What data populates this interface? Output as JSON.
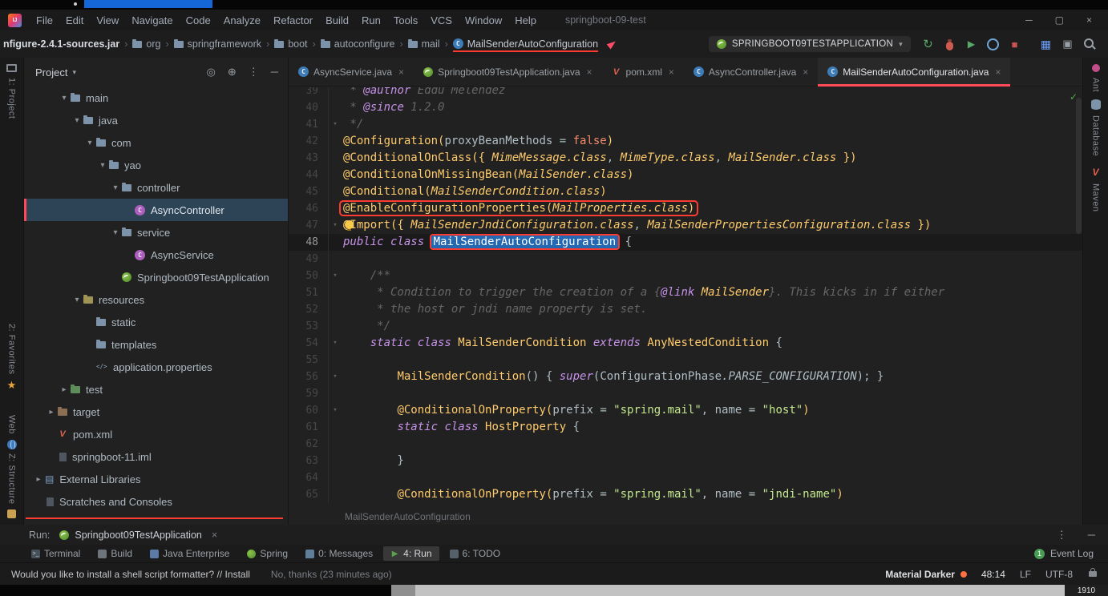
{
  "chrome": {
    "title": "springboot-09-test",
    "menus": [
      "File",
      "Edit",
      "View",
      "Navigate",
      "Code",
      "Analyze",
      "Refactor",
      "Build",
      "Run",
      "Tools",
      "VCS",
      "Window",
      "Help"
    ],
    "window_controls": {
      "minimize": "─",
      "maximize": "▢",
      "close": "×"
    }
  },
  "breadcrumb": {
    "segments": [
      {
        "label": "nfigure-2.4.1-sources.jar",
        "icon": "none",
        "bold": true
      },
      {
        "label": "org",
        "icon": "folder"
      },
      {
        "label": "springframework",
        "icon": "folder"
      },
      {
        "label": "boot",
        "icon": "folder"
      },
      {
        "label": "autoconfigure",
        "icon": "folder"
      },
      {
        "label": "mail",
        "icon": "folder"
      },
      {
        "label": "MailSenderAutoConfiguration",
        "icon": "class",
        "underline": true
      }
    ]
  },
  "run_config": {
    "name": "SPRINGBOOT09TESTAPPLICATION"
  },
  "toolbar_actions": [
    "rerun",
    "debug",
    "run-coverage",
    "profiler",
    "stop",
    "view-grid",
    "console",
    "search"
  ],
  "project_panel": {
    "header_label": "Project",
    "tree": [
      {
        "label": "main",
        "icon": "folder",
        "level": 2,
        "chevron": "down"
      },
      {
        "label": "java",
        "icon": "folder",
        "level": 3,
        "chevron": "down"
      },
      {
        "label": "com",
        "icon": "folder",
        "level": 4,
        "chevron": "down"
      },
      {
        "label": "yao",
        "icon": "folder",
        "level": 5,
        "chevron": "down"
      },
      {
        "label": "controller",
        "icon": "package",
        "level": 6,
        "chevron": "down"
      },
      {
        "label": "AsyncController",
        "icon": "class",
        "level": 7,
        "chevron": "none",
        "selected": true
      },
      {
        "label": "service",
        "icon": "package",
        "level": 6,
        "chevron": "down"
      },
      {
        "label": "AsyncService",
        "icon": "class",
        "level": 7,
        "chevron": "none"
      },
      {
        "label": "Springboot09TestApplication",
        "icon": "spring",
        "level": 6,
        "chevron": "none"
      },
      {
        "label": "resources",
        "icon": "folder-res",
        "level": 3,
        "chevron": "down"
      },
      {
        "label": "static",
        "icon": "folder",
        "level": 4,
        "chevron": "none"
      },
      {
        "label": "templates",
        "icon": "folder",
        "level": 4,
        "chevron": "none"
      },
      {
        "label": "application.properties",
        "icon": "props",
        "level": 4,
        "chevron": "none"
      },
      {
        "label": "test",
        "icon": "folder-test",
        "level": 2,
        "chevron": "right"
      },
      {
        "label": "target",
        "icon": "folder-target",
        "level": 1,
        "chevron": "right"
      },
      {
        "label": "pom.xml",
        "icon": "maven",
        "level": 1,
        "chevron": "none"
      },
      {
        "label": "springboot-11.iml",
        "icon": "file",
        "level": 1,
        "chevron": "none"
      },
      {
        "label": "External Libraries",
        "icon": "lib",
        "level": 0,
        "chevron": "right"
      },
      {
        "label": "Scratches and Consoles",
        "icon": "scratch",
        "level": 0,
        "chevron": "none"
      }
    ]
  },
  "editor": {
    "tabs": [
      {
        "label": "AsyncService.java",
        "icon": "class"
      },
      {
        "label": "Springboot09TestApplication.java",
        "icon": "spring"
      },
      {
        "label": "pom.xml",
        "icon": "maven"
      },
      {
        "label": "AsyncController.java",
        "icon": "class"
      },
      {
        "label": "MailSenderAutoConfiguration.java",
        "icon": "class",
        "active": true
      }
    ],
    "breadcrumb": "MailSenderAutoConfiguration",
    "lines": [
      {
        "n": 39,
        "t": [
          [
            "g",
            " * "
          ],
          [
            "t",
            "@author"
          ],
          [
            "g",
            " Eddú Meléndez"
          ]
        ]
      },
      {
        "n": 40,
        "t": [
          [
            "g",
            " * "
          ],
          [
            "t",
            "@since"
          ],
          [
            "g",
            " 1.2.0"
          ]
        ]
      },
      {
        "n": 41,
        "fold": true,
        "t": [
          [
            "g",
            " */"
          ]
        ]
      },
      {
        "n": 42,
        "t": [
          [
            "a",
            "@Configuration("
          ],
          [
            "p",
            "proxyBeanMethods = "
          ],
          [
            "o",
            "false"
          ],
          [
            "a",
            ")"
          ]
        ]
      },
      {
        "n": 43,
        "t": [
          [
            "a",
            "@ConditionalOnClass({ "
          ],
          [
            "ci",
            "MimeMessage.class"
          ],
          [
            "p",
            ", "
          ],
          [
            "ci",
            "MimeType.class"
          ],
          [
            "p",
            ", "
          ],
          [
            "ci",
            "MailSender.class"
          ],
          [
            "a",
            " })"
          ]
        ]
      },
      {
        "n": 44,
        "t": [
          [
            "a",
            "@ConditionalOnMissingBean("
          ],
          [
            "ci",
            "MailSender.class"
          ],
          [
            "a",
            ")"
          ]
        ]
      },
      {
        "n": 45,
        "t": [
          [
            "a",
            "@Conditional("
          ],
          [
            "ci",
            "MailSenderCondition.class"
          ],
          [
            "a",
            ")"
          ]
        ]
      },
      {
        "n": 46,
        "box": true,
        "t": [
          [
            "a",
            "@EnableConfigurationProperties("
          ],
          [
            "ci",
            "MailProperties.class"
          ],
          [
            "a",
            ")"
          ]
        ]
      },
      {
        "n": 47,
        "fold": true,
        "bulb": true,
        "t": [
          [
            "a",
            "@Import({ "
          ],
          [
            "ci",
            "MailSenderJndiConfiguration.class"
          ],
          [
            "p",
            ", "
          ],
          [
            "ci",
            "MailSenderPropertiesConfiguration.class"
          ],
          [
            "a",
            " })"
          ]
        ]
      },
      {
        "n": 48,
        "caret": true,
        "t": [
          [
            "k",
            "public class "
          ],
          [
            "sel",
            "MailSenderAutoConfiguration"
          ],
          [
            "p",
            " {"
          ]
        ]
      },
      {
        "n": 49,
        "t": []
      },
      {
        "n": 50,
        "fold": true,
        "t": [
          [
            "g",
            "    /**"
          ]
        ]
      },
      {
        "n": 51,
        "t": [
          [
            "g",
            "     * Condition to trigger the creation of a {"
          ],
          [
            "t",
            "@link"
          ],
          [
            "ci",
            " MailSender"
          ],
          [
            "g",
            "}. This kicks in if either"
          ]
        ]
      },
      {
        "n": 52,
        "t": [
          [
            "g",
            "     * the host or jndi name property is set."
          ]
        ]
      },
      {
        "n": 53,
        "t": [
          [
            "g",
            "     */"
          ]
        ]
      },
      {
        "n": 54,
        "fold": true,
        "t": [
          [
            "p",
            "    "
          ],
          [
            "k",
            "static class "
          ],
          [
            "c",
            "MailSenderCondition"
          ],
          [
            "k",
            " extends "
          ],
          [
            "c",
            "AnyNestedCondition"
          ],
          [
            "p",
            " {"
          ]
        ]
      },
      {
        "n": 55,
        "t": []
      },
      {
        "n": 56,
        "fold": true,
        "t": [
          [
            "p",
            "        "
          ],
          [
            "c",
            "MailSenderCondition"
          ],
          [
            "p",
            "() { "
          ],
          [
            "k",
            "super"
          ],
          [
            "p",
            "(ConfigurationPhase"
          ],
          [
            "pi",
            ".PARSE_CONFIGURATION"
          ],
          [
            "p",
            "); }"
          ]
        ]
      },
      {
        "n": 59,
        "t": []
      },
      {
        "n": 60,
        "fold": true,
        "t": [
          [
            "p",
            "        "
          ],
          [
            "a",
            "@ConditionalOnProperty("
          ],
          [
            "p",
            "prefix = "
          ],
          [
            "s",
            "\"spring.mail\""
          ],
          [
            "p",
            ", name = "
          ],
          [
            "s",
            "\"host\""
          ],
          [
            "a",
            ")"
          ]
        ]
      },
      {
        "n": 61,
        "t": [
          [
            "p",
            "        "
          ],
          [
            "k",
            "static class "
          ],
          [
            "c",
            "HostProperty"
          ],
          [
            "p",
            " {"
          ]
        ]
      },
      {
        "n": 62,
        "t": []
      },
      {
        "n": 63,
        "t": [
          [
            "p",
            "        }"
          ]
        ]
      },
      {
        "n": 64,
        "t": []
      },
      {
        "n": 65,
        "t": [
          [
            "p",
            "        "
          ],
          [
            "a",
            "@ConditionalOnProperty("
          ],
          [
            "p",
            "prefix = "
          ],
          [
            "s",
            "\"spring.mail\""
          ],
          [
            "p",
            ", name = "
          ],
          [
            "s",
            "\"jndi-name\""
          ],
          [
            "a",
            ")"
          ]
        ]
      }
    ]
  },
  "tool_strips": {
    "left": [
      {
        "label": "1: Project",
        "icon": "project"
      },
      {
        "label": "2: Favorites",
        "icon": "star"
      },
      {
        "label": "Web",
        "icon": "globe"
      },
      {
        "label": "Z: Structure",
        "icon": "structure"
      }
    ],
    "right": [
      {
        "label": "Ant",
        "icon": "ant"
      },
      {
        "label": "Database",
        "icon": "database"
      },
      {
        "label": "Maven",
        "icon": "maven"
      }
    ]
  },
  "run_panel": {
    "label": "Run:",
    "tab": "Springboot09TestApplication",
    "close": "×"
  },
  "tool_window_bar": {
    "items": [
      {
        "label": "Terminal",
        "icon": "terminal"
      },
      {
        "label": "Build",
        "icon": "build"
      },
      {
        "label": "Java Enterprise",
        "icon": "javaee"
      },
      {
        "label": "Spring",
        "icon": "spring"
      },
      {
        "label": "0: Messages",
        "icon": "messages"
      },
      {
        "label": "4: Run",
        "icon": "run",
        "active": true
      },
      {
        "label": "6: TODO",
        "icon": "todo"
      }
    ],
    "event_log": {
      "label": "Event Log",
      "badge": "1"
    }
  },
  "status_bar": {
    "message": "Would you like to install a shell script formatter? // Install",
    "dismiss": "No, thanks (23 minutes ago)",
    "theme": "Material Darker",
    "caret_position": "48:14",
    "line_separator": "LF",
    "encoding": "UTF-8"
  },
  "taskbar": {
    "clock": "1910"
  },
  "colors": {
    "annotation_red": "#FF3B31",
    "selection_blue": "#2368B0",
    "tab_accent": "#FF4B57",
    "spring_green": "#6DB33F",
    "editor_background": "#212121"
  }
}
